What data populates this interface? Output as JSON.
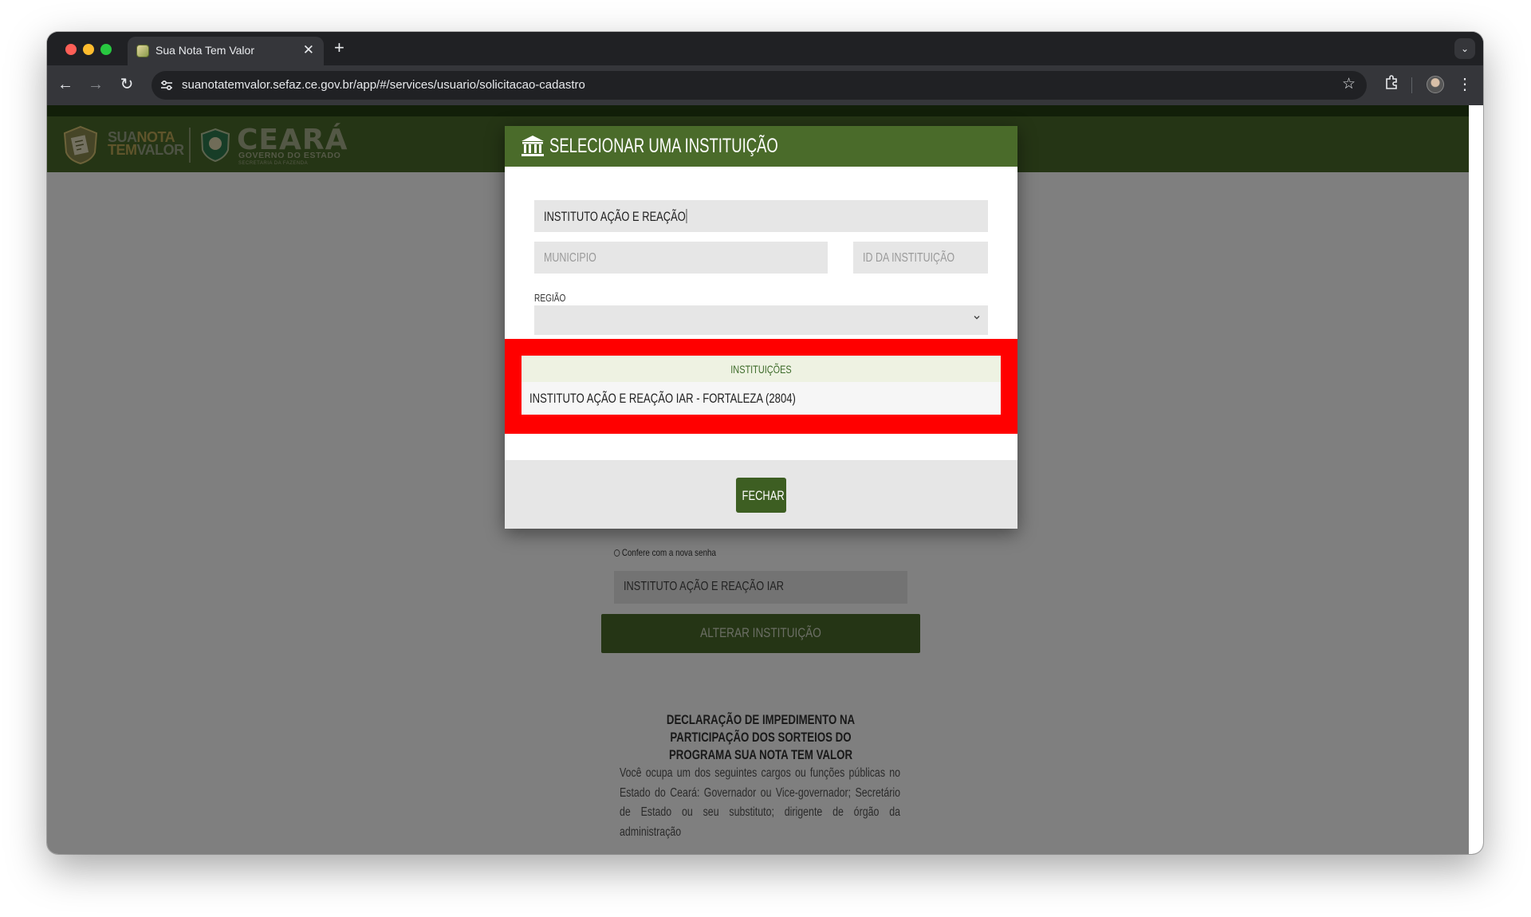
{
  "browser": {
    "tab_title": "Sua Nota Tem Valor",
    "url": "suanotatemvalor.sefaz.ce.gov.br/app/#/services/usuario/solicitacao-cadastro"
  },
  "header": {
    "logo_sua": "SUA",
    "logo_nota": "NOTA",
    "logo_tem": "TEM",
    "logo_valor": "VALOR",
    "logo_ceara": "CEARÁ",
    "logo_governo": "GOVERNO DO ESTADO",
    "logo_secretaria": "SECRETARIA DA FAZENDA"
  },
  "background_form": {
    "radio_label": "Confere com a nova senha",
    "institution_value": "INSTITUTO AÇÃO E REAÇÃO IAR",
    "alter_button": "ALTERAR INSTITUIÇÃO",
    "declaration_title": "DECLARAÇÃO DE IMPEDIMENTO NA PARTICIPAÇÃO DOS SORTEIOS DO PROGRAMA SUA NOTA TEM VALOR",
    "declaration_text": "Você ocupa um dos seguintes cargos ou funções públicas no Estado do Ceará: Governador ou Vice-governador; Secretário de Estado ou seu substituto; dirigente de órgão da administração"
  },
  "modal": {
    "title": "SELECIONAR UMA INSTITUIÇÃO",
    "search_value": "INSTITUTO AÇÃO E REAÇÃO",
    "municipio_placeholder": "MUNICIPIO",
    "id_placeholder": "ID DA INSTITUIÇÃO",
    "regiao_label": "REGIÃO",
    "regiao_value": "",
    "results_header": "INSTITUIÇÕES",
    "results": [
      "INSTITUTO AÇÃO E REAÇÃO IAR - FORTALEZA (2804)"
    ],
    "close_button": "FECHAR"
  },
  "colors": {
    "brand_green": "#4a6b2a",
    "button_green": "#3d5e22",
    "highlight_red": "#ff0000"
  }
}
